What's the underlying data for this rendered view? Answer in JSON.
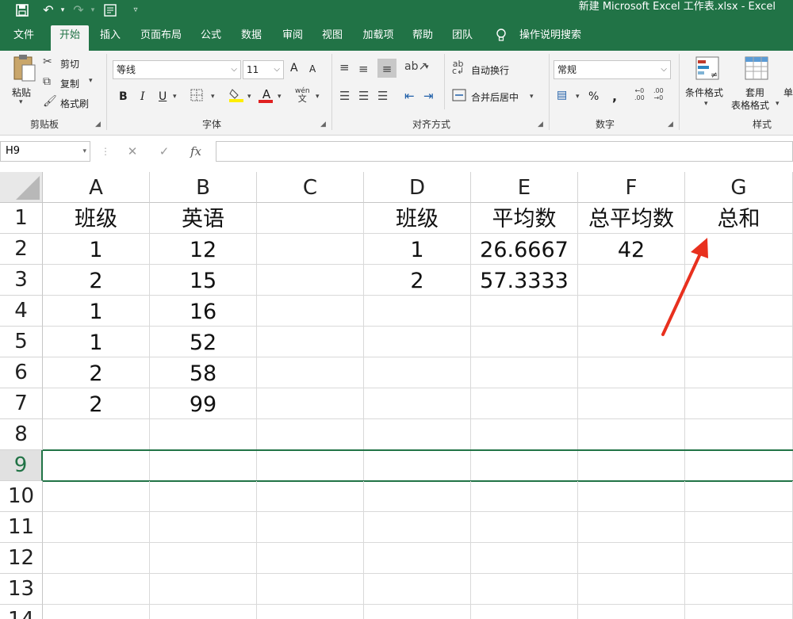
{
  "window": {
    "title": "新建 Microsoft Excel 工作表.xlsx  -  Excel"
  },
  "tabs": [
    "文件",
    "开始",
    "插入",
    "页面布局",
    "公式",
    "数据",
    "审阅",
    "视图",
    "加载项",
    "帮助",
    "团队"
  ],
  "tell_me": "操作说明搜索",
  "ribbon": {
    "clipboard": {
      "paste": "粘贴",
      "cut": "剪切",
      "copy": "复制",
      "format_painter": "格式刷",
      "label": "剪贴板"
    },
    "font": {
      "name": "等线",
      "size": "11",
      "grow": "A",
      "shrink": "A",
      "bold": "B",
      "italic": "I",
      "underline": "U",
      "font_color_letter": "A",
      "phonetic": "wén\n文",
      "label": "字体"
    },
    "alignment": {
      "wrap": "自动换行",
      "merge": "合并后居中",
      "label": "对齐方式"
    },
    "number": {
      "format": "常规",
      "percent": "%",
      "comma": ",",
      "inc_dec": ".00",
      "label": "数字"
    },
    "styles": {
      "conditional": "条件格式",
      "table_format_1": "套用",
      "table_format_2": "表格格式",
      "cell_style": "单",
      "label": "样式"
    }
  },
  "formula_bar": {
    "name_box": "H9",
    "cancel": "✕",
    "enter": "✓",
    "fx": "fx",
    "value": ""
  },
  "columns": [
    "A",
    "B",
    "C",
    "D",
    "E",
    "F",
    "G"
  ],
  "rows": [
    "1",
    "2",
    "3",
    "4",
    "5",
    "6",
    "7",
    "8",
    "9",
    "10",
    "11",
    "12",
    "13",
    "14"
  ],
  "active_row": "9",
  "cells": {
    "A1": "班级",
    "B1": "英语",
    "D1": "班级",
    "E1": "平均数",
    "F1": "总平均数",
    "G1": "总和",
    "A2": "1",
    "B2": "12",
    "D2": "1",
    "E2": "26.6667",
    "F2": "42",
    "A3": "2",
    "B3": "15",
    "D3": "2",
    "E3": "57.3333",
    "A4": "1",
    "B4": "16",
    "A5": "1",
    "B5": "52",
    "A6": "2",
    "B6": "58",
    "A7": "2",
    "B7": "99"
  },
  "colors": {
    "excel_green": "#217346",
    "arrow_red": "#e8301e"
  }
}
